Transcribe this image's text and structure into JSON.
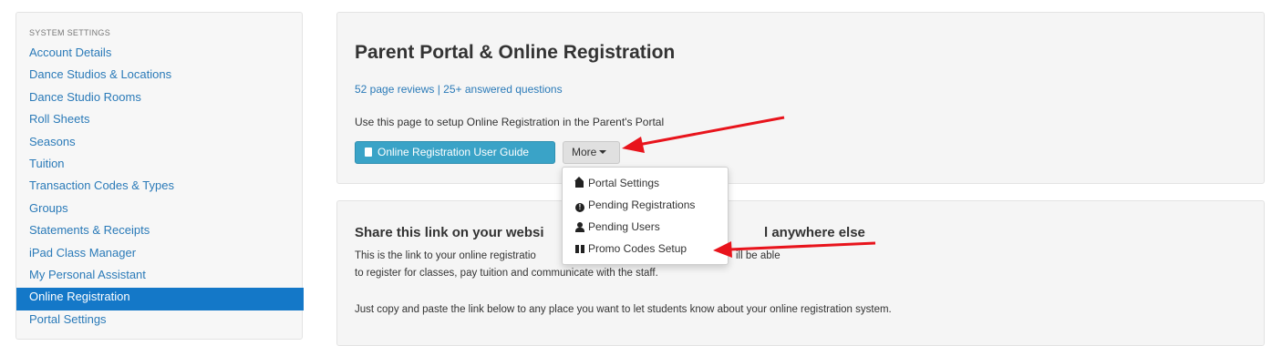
{
  "sidebar": {
    "heading": "SYSTEM SETTINGS",
    "items": [
      {
        "label": "Account Details"
      },
      {
        "label": "Dance Studios & Locations"
      },
      {
        "label": "Dance Studio Rooms"
      },
      {
        "label": "Roll Sheets"
      },
      {
        "label": "Seasons"
      },
      {
        "label": "Tuition"
      },
      {
        "label": "Transaction Codes & Types"
      },
      {
        "label": "Groups"
      },
      {
        "label": "Statements & Receipts"
      },
      {
        "label": "iPad Class Manager"
      },
      {
        "label": "My Personal Assistant"
      },
      {
        "label": "Online Registration"
      },
      {
        "label": "Portal Settings"
      }
    ],
    "active_label": "Online Registration"
  },
  "main": {
    "title": "Parent Portal & Online Registration",
    "reviews_link": "52 page reviews | 25+ answered questions",
    "intro": "Use this page to setup Online Registration in the Parent's Portal",
    "guide_button": "Online Registration User Guide",
    "more_button": "More",
    "share_heading_start": "Share this link on your websi",
    "share_heading_end": "l anywhere else",
    "share_text1_start": "This is the link to your online registratio",
    "share_text1_end": "ill be able",
    "share_text2": "to register for classes, pay tuition and communicate with the staff.",
    "share_text3": "Just copy and paste the link below to any place you want to let students know about your online registration system."
  },
  "dropdown": {
    "items": [
      {
        "label": "Portal Settings",
        "icon": "home-icon"
      },
      {
        "label": "Pending Registrations",
        "icon": "exclamation-circle-icon"
      },
      {
        "label": "Pending Users",
        "icon": "user-icon"
      },
      {
        "label": "Promo Codes Setup",
        "icon": "gift-icon"
      }
    ]
  },
  "colors": {
    "link": "#2a7ab8",
    "active_bg": "#1478c8",
    "guide_button": "#3aa3c7",
    "annotation_arrow": "#e8141c"
  }
}
